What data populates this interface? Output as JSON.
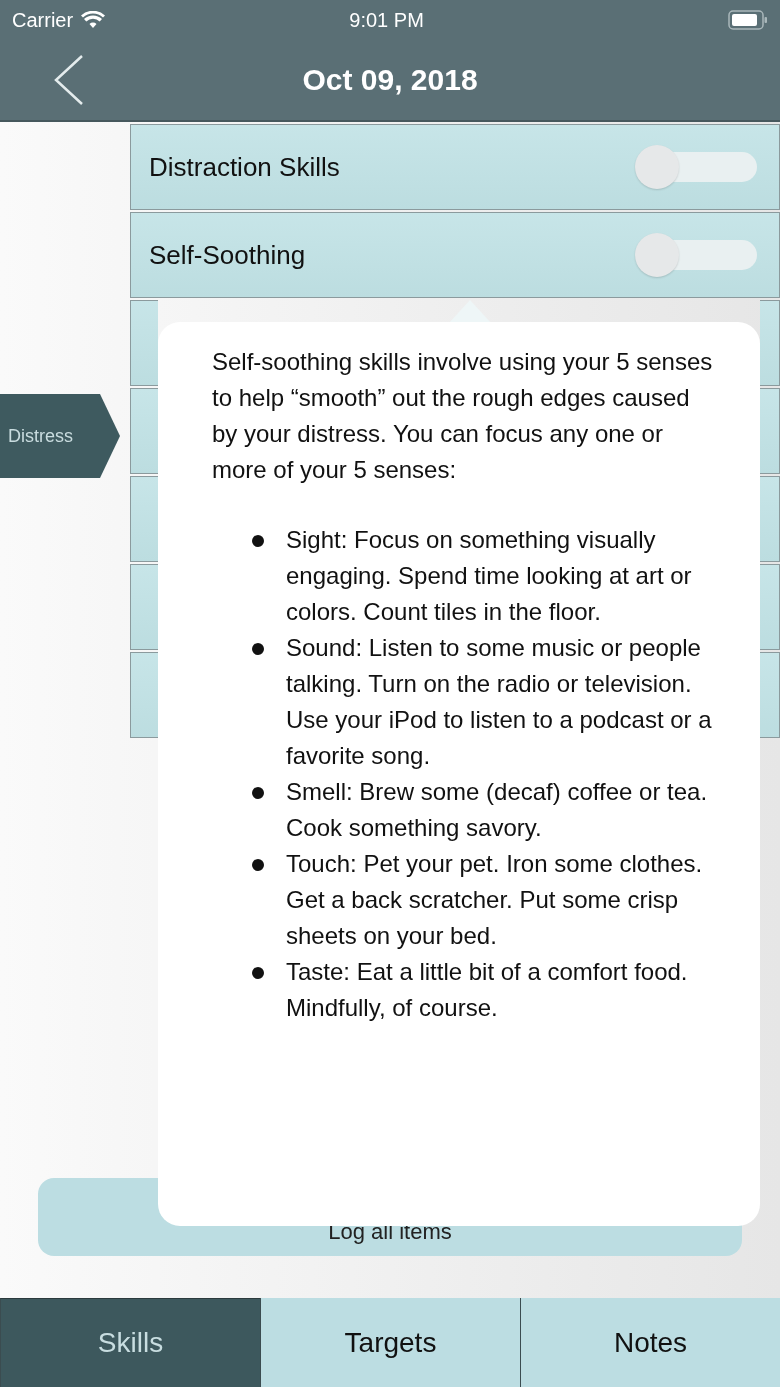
{
  "status_bar": {
    "carrier": "Carrier",
    "time": "9:01 PM"
  },
  "nav": {
    "title": "Oct 09, 2018"
  },
  "category": {
    "label": "Distress"
  },
  "skills": [
    {
      "kind": "toggle",
      "label": "Distraction Skills",
      "on": false
    },
    {
      "kind": "toggle",
      "label": "Self-Soothing",
      "on": false
    },
    {
      "kind": "covered"
    },
    {
      "kind": "covered"
    },
    {
      "kind": "covered"
    },
    {
      "kind": "covered"
    },
    {
      "kind": "covered"
    }
  ],
  "log_button": {
    "label": "Log all items"
  },
  "popover": {
    "intro": "Self-soothing skills involve using your 5 senses to help “smooth” out the rough edges caused by your distress. You can focus any one or more of your 5 senses:",
    "bullets": [
      "Sight: Focus on something visually engaging. Spend time looking at art or colors. Count tiles in the floor.",
      "Sound: Listen to some music or people talking. Turn on the radio or television. Use your iPod to listen to a podcast or a favorite song.",
      "Smell: Brew some (decaf) coffee or tea. Cook something savory.",
      "Touch: Pet your pet. Iron some clothes. Get a back scratcher. Put some crisp sheets on your bed.",
      "Taste: Eat a little bit of a comfort food. Mindfully, of course."
    ]
  },
  "tabs": [
    {
      "label": "Skills",
      "selected": true
    },
    {
      "label": "Targets",
      "selected": false
    },
    {
      "label": "Notes",
      "selected": false
    }
  ]
}
